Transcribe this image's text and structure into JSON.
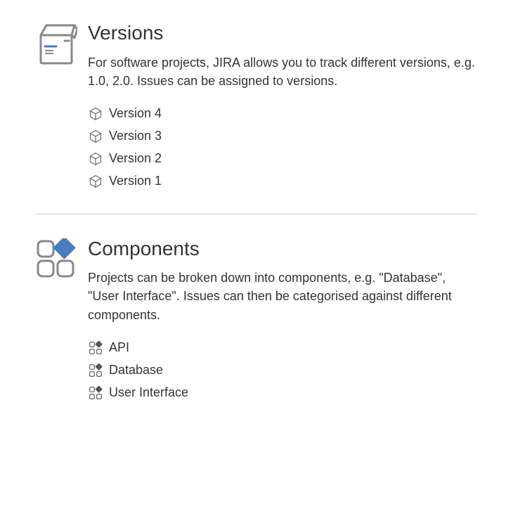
{
  "sections": [
    {
      "title": "Versions",
      "description": "For software projects, JIRA allows you to track different versions, e.g. 1.0, 2.0. Issues can be assigned to versions.",
      "items": [
        {
          "label": "Version 4"
        },
        {
          "label": "Version 3"
        },
        {
          "label": "Version 2"
        },
        {
          "label": "Version 1"
        }
      ]
    },
    {
      "title": "Components",
      "description": "Projects can be broken down into components, e.g. \"Database\", \"User Interface\". Issues can then be categorised against different components.",
      "items": [
        {
          "label": "API"
        },
        {
          "label": "Database"
        },
        {
          "label": "User Interface"
        }
      ]
    }
  ]
}
